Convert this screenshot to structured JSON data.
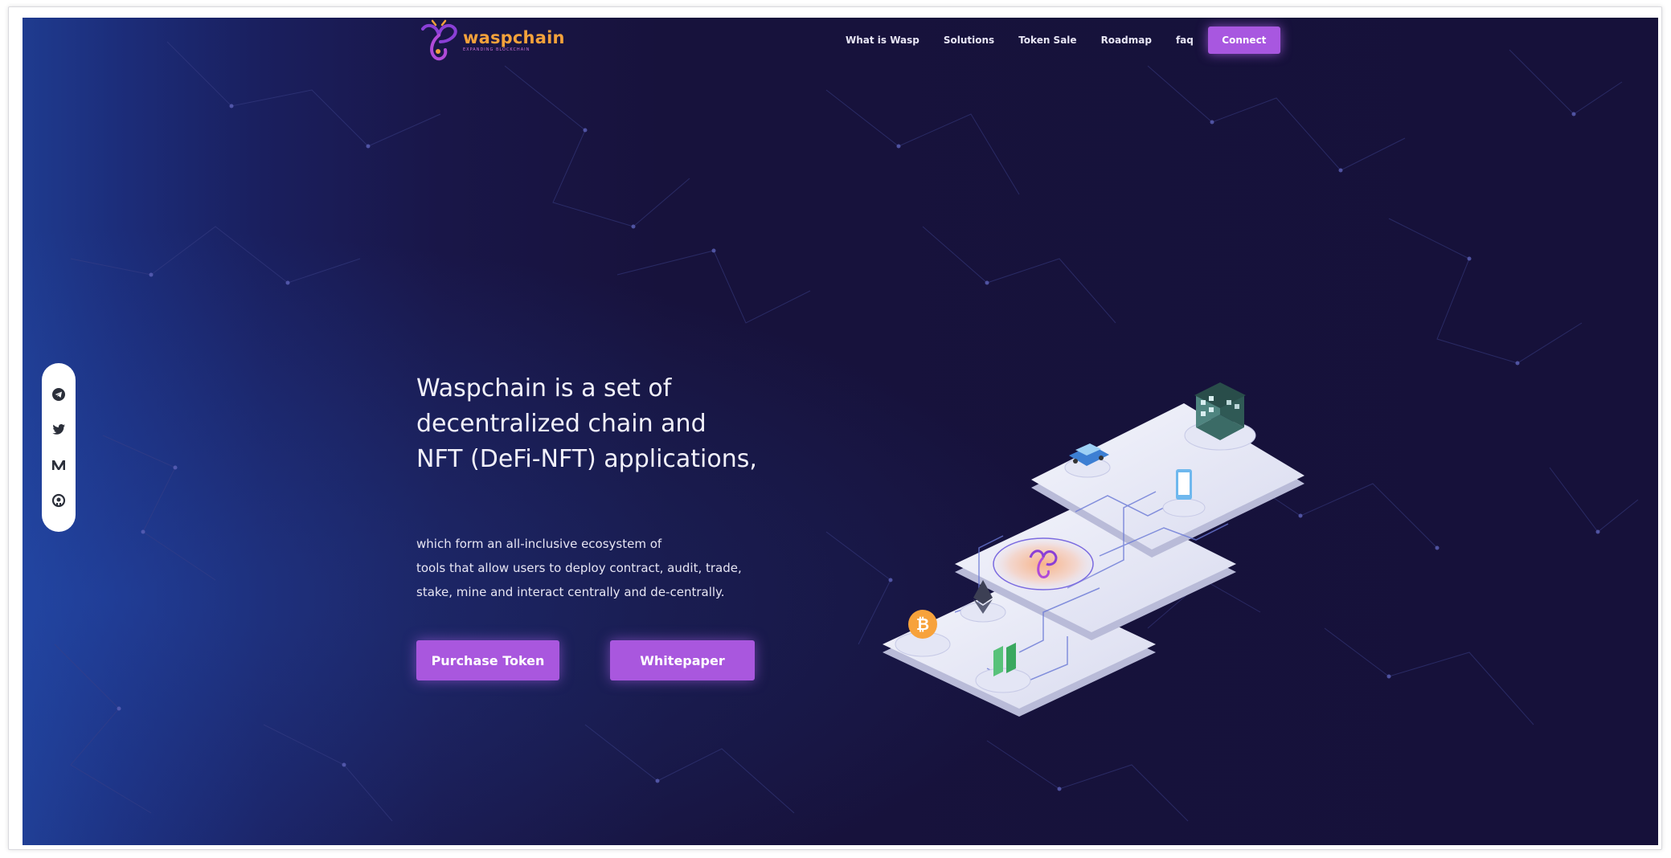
{
  "brand": {
    "name": "waspchain",
    "tagline": "EXPANDING BLOCKCHAIN",
    "accent": "#f4a23b",
    "brand_purple": "#a857e0"
  },
  "nav": {
    "items": [
      "What is Wasp",
      "Solutions",
      "Token Sale",
      "Roadmap",
      "faq"
    ],
    "connect_label": "Connect"
  },
  "social": {
    "icons": [
      "telegram-icon",
      "twitter-icon",
      "medium-icon",
      "github-icon"
    ]
  },
  "hero": {
    "title_lines": [
      "Waspchain is a set of",
      "decentralized chain and",
      "NFT (DeFi-NFT) applications,"
    ],
    "description_lines": [
      "which form an all-inclusive ecosystem of",
      "tools that allow users to deploy contract, audit, trade,",
      "stake, mine and interact centrally and de-centrally."
    ],
    "purchase_label": "Purchase Token",
    "whitepaper_label": "Whitepaper"
  },
  "colors": {
    "background_dark": "#16113a",
    "background_blue": "#1f3b8f",
    "button": "#a957de"
  }
}
